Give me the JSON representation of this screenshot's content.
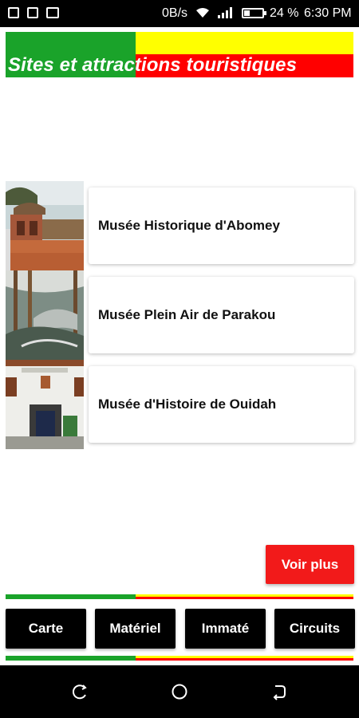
{
  "status_bar": {
    "network_speed": "0B/s",
    "battery_level": "24 %",
    "time": "6:30 PM"
  },
  "header": {
    "title": "Sites et attractions touristiques",
    "colors": {
      "green": "#1aa32a",
      "yellow": "#ffff00",
      "red": "#ff0000"
    }
  },
  "sites": [
    {
      "name": "Musée Historique d'Abomey",
      "thumbnail": "abomey-museum-photo"
    },
    {
      "name": "Musée Plein Air de Parakou",
      "thumbnail": "parakou-open-air-museum-photo"
    },
    {
      "name": "Musée d'Histoire de Ouidah",
      "thumbnail": "ouidah-history-museum-photo"
    }
  ],
  "actions": {
    "voir_plus": "Voir plus",
    "voir_plus_color": "#f21a1a"
  },
  "bottom_nav": {
    "carte": "Carte",
    "materiel": "Matériel",
    "immate": "Immaté",
    "circuits": "Circuits"
  },
  "system_nav": {
    "icons": [
      "recent-apps-icon",
      "home-icon",
      "back-icon"
    ]
  }
}
